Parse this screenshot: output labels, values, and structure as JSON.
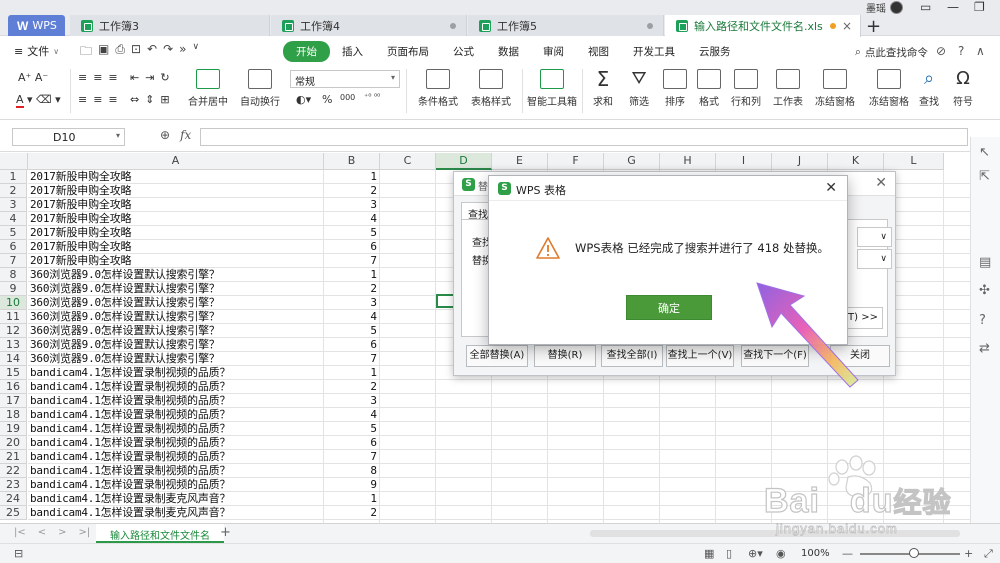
{
  "titlebar": {
    "app_button": "WPS",
    "tabs": [
      {
        "label": "工作簿3"
      },
      {
        "label": "工作簿4"
      },
      {
        "label": "工作簿5"
      },
      {
        "label": "输入路径和文件文件名.xls"
      }
    ],
    "user_name": "墨瑶"
  },
  "menu": {
    "file_label": "文件",
    "tabs": [
      "开始",
      "插入",
      "页面布局",
      "公式",
      "数据",
      "审阅",
      "视图",
      "开发工具",
      "云服务"
    ],
    "active_tab": "开始",
    "search_cmd": "点此查找命令"
  },
  "ribbon": {
    "merge_center": "合并居中",
    "wrap_text": "自动换行",
    "number_format": "常规",
    "conditional_format": "条件格式",
    "table_style": "表格样式",
    "smart_toolbox": "智能工具箱",
    "sum": "求和",
    "filter": "筛选",
    "sort": "排序",
    "format": "格式",
    "row_col": "行和列",
    "worksheet": "工作表",
    "freeze1": "冻结窗格",
    "freeze2": "冻结窗格",
    "find": "查找",
    "symbol": "符号",
    "percent": "%",
    "thousands": "000"
  },
  "formula_bar": {
    "cell_ref": "D10",
    "fx": "fx",
    "value": ""
  },
  "grid": {
    "columns": [
      "A",
      "B",
      "C",
      "D",
      "E",
      "F",
      "G",
      "H",
      "I",
      "J",
      "K",
      "L"
    ],
    "selected_column": "D",
    "selected_row": "10",
    "rows": [
      {
        "n": "1",
        "a": "2017新股申购全攻略",
        "b": "1"
      },
      {
        "n": "2",
        "a": "2017新股申购全攻略",
        "b": "2"
      },
      {
        "n": "3",
        "a": "2017新股申购全攻略",
        "b": "3"
      },
      {
        "n": "4",
        "a": "2017新股申购全攻略",
        "b": "4"
      },
      {
        "n": "5",
        "a": "2017新股申购全攻略",
        "b": "5"
      },
      {
        "n": "6",
        "a": "2017新股申购全攻略",
        "b": "6"
      },
      {
        "n": "7",
        "a": "2017新股申购全攻略",
        "b": "7"
      },
      {
        "n": "8",
        "a": "360浏览器9.0怎样设置默认搜索引擎？",
        "b": "1"
      },
      {
        "n": "9",
        "a": "360浏览器9.0怎样设置默认搜索引擎？",
        "b": "2"
      },
      {
        "n": "10",
        "a": "360浏览器9.0怎样设置默认搜索引擎？",
        "b": "3"
      },
      {
        "n": "11",
        "a": "360浏览器9.0怎样设置默认搜索引擎？",
        "b": "4"
      },
      {
        "n": "12",
        "a": "360浏览器9.0怎样设置默认搜索引擎？",
        "b": "5"
      },
      {
        "n": "13",
        "a": "360浏览器9.0怎样设置默认搜索引擎？",
        "b": "6"
      },
      {
        "n": "14",
        "a": "360浏览器9.0怎样设置默认搜索引擎？",
        "b": "7"
      },
      {
        "n": "15",
        "a": "bandicam4.1怎样设置录制视频的品质？",
        "b": "1"
      },
      {
        "n": "16",
        "a": "bandicam4.1怎样设置录制视频的品质？",
        "b": "2"
      },
      {
        "n": "17",
        "a": "bandicam4.1怎样设置录制视频的品质？",
        "b": "3"
      },
      {
        "n": "18",
        "a": "bandicam4.1怎样设置录制视频的品质？",
        "b": "4"
      },
      {
        "n": "19",
        "a": "bandicam4.1怎样设置录制视频的品质？",
        "b": "5"
      },
      {
        "n": "20",
        "a": "bandicam4.1怎样设置录制视频的品质？",
        "b": "6"
      },
      {
        "n": "21",
        "a": "bandicam4.1怎样设置录制视频的品质？",
        "b": "7"
      },
      {
        "n": "22",
        "a": "bandicam4.1怎样设置录制视频的品质？",
        "b": "8"
      },
      {
        "n": "23",
        "a": "bandicam4.1怎样设置录制视频的品质？",
        "b": "9"
      },
      {
        "n": "24",
        "a": "bandicam4.1怎样设置录制麦克风声音？",
        "b": "1"
      },
      {
        "n": "25",
        "a": "bandicam4.1怎样设置录制麦克风声音？",
        "b": "2"
      }
    ]
  },
  "sheetbar": {
    "active_sheet": "输入路径和文件文件名",
    "add": "+"
  },
  "statusbar": {
    "zoom": "100%"
  },
  "find_replace": {
    "title_fragment": "替",
    "tab_fragment": "查找",
    "find_label_fragment": "查找",
    "replace_label_fragment": "替换",
    "options_fragment": "(T) >>",
    "buttons": {
      "replace_all": "全部替换(A)",
      "replace": "替换(R)",
      "find_all": "查找全部(I)",
      "find_prev": "查找上一个(V)",
      "find_next": "查找下一个(F)",
      "close": "关闭"
    }
  },
  "alert": {
    "title": "WPS 表格",
    "message": "WPS表格 已经完成了搜索并进行了 418 处替换。",
    "ok": "确定",
    "logo_letter": "S"
  },
  "watermark": {
    "brand": "Bai",
    "brand2": "du",
    "cn": "经验",
    "url": "jingyan.baidu.com"
  },
  "colors": {
    "accent_green": "#2fa048",
    "wps_blue": "#5f7fd6",
    "ok_button": "#4a9a3a",
    "warning_orange": "#e07a2a"
  }
}
